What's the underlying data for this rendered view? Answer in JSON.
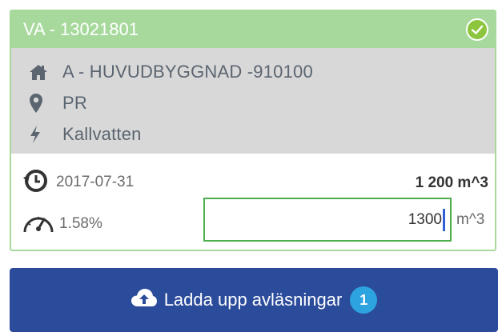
{
  "card": {
    "title": "VA - 13021801",
    "status_icon": "check-icon",
    "accent": "#a7d99d"
  },
  "info": {
    "building": {
      "icon": "home-icon",
      "text": "A - HUVUDBYGGNAD -910100"
    },
    "location": {
      "icon": "map-pin-icon",
      "text": "PR"
    },
    "type": {
      "icon": "bolt-icon",
      "text": "Kallvatten"
    }
  },
  "reading": {
    "date_icon": "history-icon",
    "date": "2017-07-31",
    "previous_value": "1 200 m^3",
    "usage_icon": "speedometer-icon",
    "usage_percent": "1.58%",
    "input_value": "1300",
    "unit": "m^3"
  },
  "upload": {
    "icon": "cloud-upload-icon",
    "label": "Ladda upp avläsningar",
    "count": "1",
    "color": "#2b4b9b",
    "badge_color": "#2da3e0"
  }
}
